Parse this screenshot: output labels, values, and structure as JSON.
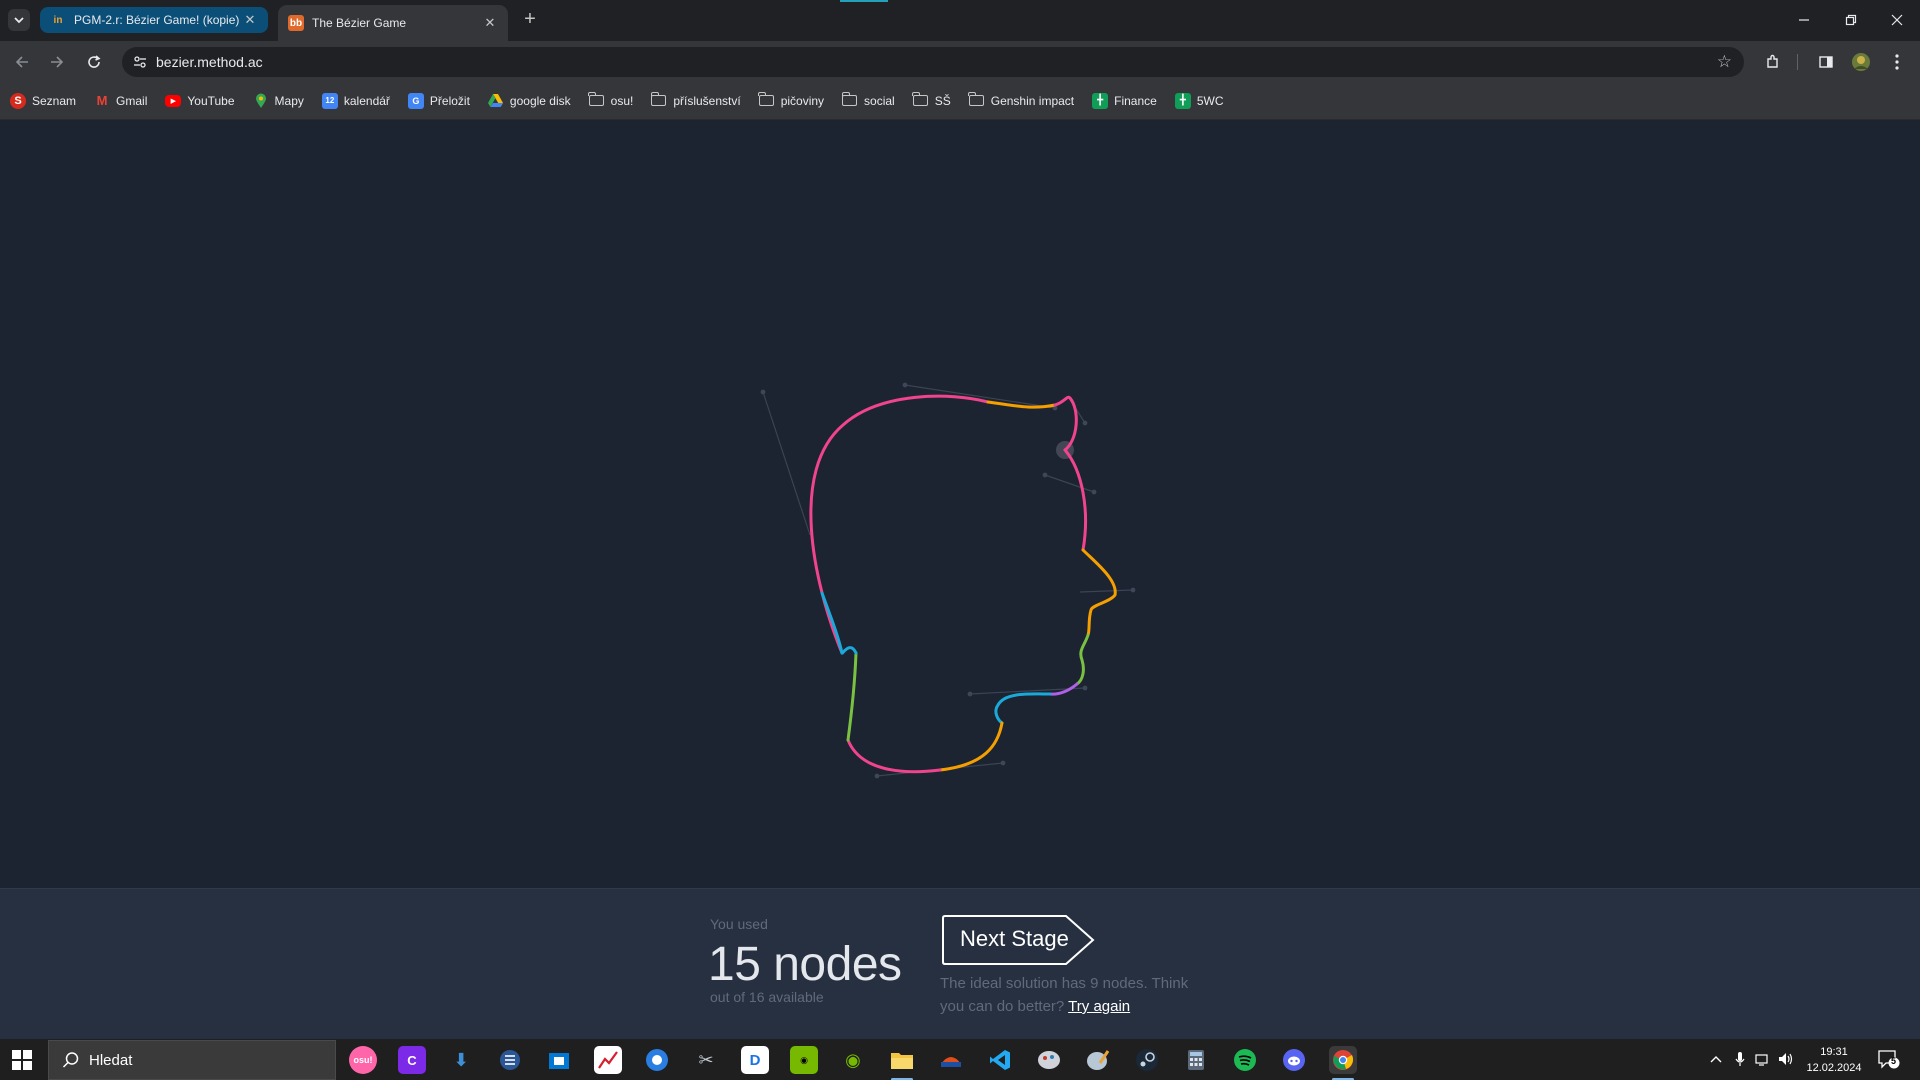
{
  "browser": {
    "tabs": [
      {
        "title": "PGM-2.r: Bézier Game! (kopie)",
        "favicon": "in",
        "favicon_color": "#f0a030",
        "active": false
      },
      {
        "title": "The Bézier Game",
        "favicon": "bb",
        "favicon_color": "#e06a2c",
        "active": true
      }
    ],
    "url": "bezier.method.ac",
    "bookmarks": [
      {
        "label": "Seznam",
        "icon": "seznam-icon"
      },
      {
        "label": "Gmail",
        "icon": "gmail-icon"
      },
      {
        "label": "YouTube",
        "icon": "youtube-icon"
      },
      {
        "label": "Mapy",
        "icon": "maps-icon"
      },
      {
        "label": "kalendář",
        "icon": "calendar-icon"
      },
      {
        "label": "Přeložit",
        "icon": "translate-icon"
      },
      {
        "label": "google disk",
        "icon": "drive-icon"
      },
      {
        "label": "osu!",
        "icon": "folder-icon"
      },
      {
        "label": "příslušenství",
        "icon": "folder-icon"
      },
      {
        "label": "pičoviny",
        "icon": "folder-icon"
      },
      {
        "label": "social",
        "icon": "folder-icon"
      },
      {
        "label": "SŠ",
        "icon": "folder-icon"
      },
      {
        "label": "Genshin impact",
        "icon": "folder-icon"
      },
      {
        "label": "Finance",
        "icon": "sheets-icon"
      },
      {
        "label": "5WC",
        "icon": "sheets-icon"
      }
    ]
  },
  "game": {
    "used_label": "You used",
    "nodes_text": "15 nodes",
    "available_text": "out of 16 available",
    "next_button": "Next Stage",
    "hint_text": "The ideal solution has 9 nodes. Think you can do better?",
    "try_again": "Try again",
    "nodes_used": 15,
    "nodes_available": 16,
    "ideal_nodes": 9
  },
  "taskbar": {
    "search_placeholder": "Hledat",
    "time": "19:31",
    "date": "12.02.2024",
    "notification_count": "5",
    "apps": [
      "osu",
      "canva",
      "download",
      "tasks",
      "windows-store",
      "stocks",
      "chromium",
      "snipping",
      "dictionary",
      "nvidia",
      "nvidia-broadcast",
      "file-explorer",
      "office",
      "vscode",
      "image-editor",
      "paint",
      "steam",
      "calculator",
      "spotify",
      "discord",
      "chrome"
    ]
  },
  "colors": {
    "background": "#1c2331",
    "panel": "#273040",
    "pink": "#f0448e",
    "orange": "#f5a000",
    "green": "#7ac142",
    "cyan": "#1aa9d8",
    "purple": "#b060e8"
  }
}
